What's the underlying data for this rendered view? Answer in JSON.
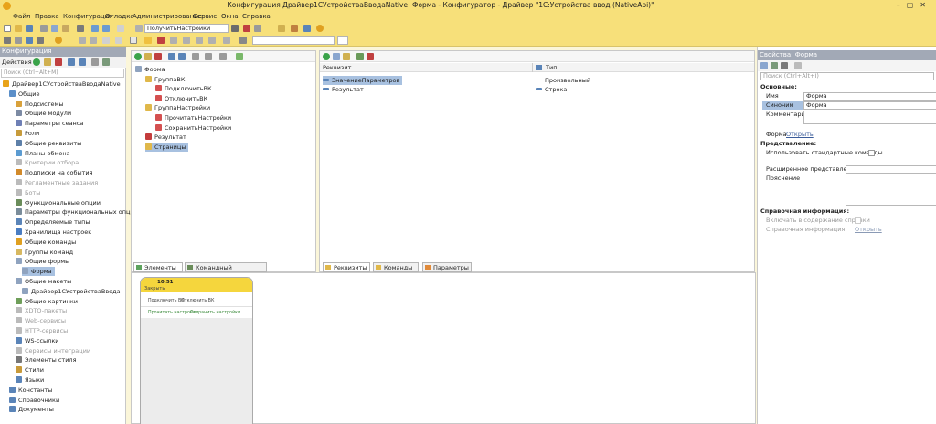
{
  "window": {
    "title": "Конфигурация Драйвер1СУстройстваВводаNative: Форма - Конфигуратор - Драйвер \"1С:Устройства ввод (NativeApi)\""
  },
  "menu": [
    "Файл",
    "Правка",
    "Конфигурация",
    "Отладка",
    "Администрирование",
    "Сервис",
    "Окна",
    "Справка"
  ],
  "toolbar": {
    "method_select": "ПолучитьНастройки"
  },
  "config_panel": {
    "title": "Конфигурация",
    "actions_label": "Действия ▾",
    "search_placeholder": "Поиск (Ctrl+Alt+M)",
    "tree": [
      {
        "label": "Драйвер1СУстройстваВводаNative",
        "level": 0,
        "muted": false,
        "selected": false,
        "color": "#e8a31a"
      },
      {
        "label": "Общие",
        "level": 1,
        "muted": false,
        "selected": false,
        "color": "#5b8fc9"
      },
      {
        "label": "Подсистемы",
        "level": 2,
        "muted": false,
        "selected": false,
        "color": "#d9a13b"
      },
      {
        "label": "Общие модули",
        "level": 2,
        "muted": false,
        "selected": false,
        "color": "#7c8aa3"
      },
      {
        "label": "Параметры сеанса",
        "level": 2,
        "muted": false,
        "selected": false,
        "color": "#6e7fb5"
      },
      {
        "label": "Роли",
        "level": 2,
        "muted": false,
        "selected": false,
        "color": "#c79b3b"
      },
      {
        "label": "Общие реквизиты",
        "level": 2,
        "muted": false,
        "selected": false,
        "color": "#5d7fa8"
      },
      {
        "label": "Планы обмена",
        "level": 2,
        "muted": false,
        "selected": false,
        "color": "#5b9bd1"
      },
      {
        "label": "Критерии отбора",
        "level": 2,
        "muted": true,
        "selected": false,
        "color": "#bbbbbb"
      },
      {
        "label": "Подписки на события",
        "level": 2,
        "muted": false,
        "selected": false,
        "color": "#d28a2a"
      },
      {
        "label": "Регламентные задания",
        "level": 2,
        "muted": true,
        "selected": false,
        "color": "#bbbbbb"
      },
      {
        "label": "Боты",
        "level": 2,
        "muted": true,
        "selected": false,
        "color": "#bbbbbb"
      },
      {
        "label": "Функциональные опции",
        "level": 2,
        "muted": false,
        "selected": false,
        "color": "#6a8c5a"
      },
      {
        "label": "Параметры функциональных опций",
        "level": 2,
        "muted": false,
        "selected": false,
        "color": "#7a8c9a"
      },
      {
        "label": "Определяемые типы",
        "level": 2,
        "muted": false,
        "selected": false,
        "color": "#5a84b8"
      },
      {
        "label": "Хранилища настроек",
        "level": 2,
        "muted": false,
        "selected": false,
        "color": "#4a7dc2"
      },
      {
        "label": "Общие команды",
        "level": 2,
        "muted": false,
        "selected": false,
        "color": "#e0a020"
      },
      {
        "label": "Группы команд",
        "level": 2,
        "muted": false,
        "selected": false,
        "color": "#d7b860"
      },
      {
        "label": "Общие формы",
        "level": 2,
        "muted": false,
        "selected": false,
        "color": "#8fa3bf"
      },
      {
        "label": "Форма",
        "level": 3,
        "muted": false,
        "selected": true,
        "color": "#8fa3bf"
      },
      {
        "label": "Общие макеты",
        "level": 2,
        "muted": false,
        "selected": false,
        "color": "#8fa3bf"
      },
      {
        "label": "Драйвер1СУстройстваВвода",
        "level": 3,
        "muted": false,
        "selected": false,
        "color": "#8fa3bf"
      },
      {
        "label": "Общие картинки",
        "level": 2,
        "muted": false,
        "selected": false,
        "color": "#6f9f5a"
      },
      {
        "label": "XDTO-пакеты",
        "level": 2,
        "muted": true,
        "selected": false,
        "color": "#bbbbbb"
      },
      {
        "label": "Web-сервисы",
        "level": 2,
        "muted": true,
        "selected": false,
        "color": "#bbbbbb"
      },
      {
        "label": "HTTP-сервисы",
        "level": 2,
        "muted": true,
        "selected": false,
        "color": "#bbbbbb"
      },
      {
        "label": "WS-ссылки",
        "level": 2,
        "muted": false,
        "selected": false,
        "color": "#5a84b8"
      },
      {
        "label": "Сервисы интеграции",
        "level": 2,
        "muted": true,
        "selected": false,
        "color": "#bbbbbb"
      },
      {
        "label": "Элементы стиля",
        "level": 2,
        "muted": false,
        "selected": false,
        "color": "#777777"
      },
      {
        "label": "Стили",
        "level": 2,
        "muted": false,
        "selected": false,
        "color": "#c89a3a"
      },
      {
        "label": "Языки",
        "level": 2,
        "muted": false,
        "selected": false,
        "color": "#5a84b8"
      },
      {
        "label": "Константы",
        "level": 1,
        "muted": false,
        "selected": false,
        "color": "#5a84b8"
      },
      {
        "label": "Справочники",
        "level": 1,
        "muted": false,
        "selected": false,
        "color": "#5a84b8"
      },
      {
        "label": "Документы",
        "level": 1,
        "muted": false,
        "selected": false,
        "color": "#5a84b8"
      }
    ]
  },
  "elements_panel": {
    "tree": [
      {
        "label": "Форма",
        "level": 0,
        "selected": false,
        "color": "#8fa3bf"
      },
      {
        "label": "ГруппаВК",
        "level": 1,
        "selected": false,
        "color": "#e0b84a"
      },
      {
        "label": "ПодключитьВК",
        "level": 2,
        "selected": false,
        "color": "#d45050"
      },
      {
        "label": "ОтключитьВК",
        "level": 2,
        "selected": false,
        "color": "#d45050"
      },
      {
        "label": "ГруппаНастройки",
        "level": 1,
        "selected": false,
        "color": "#e0b84a"
      },
      {
        "label": "ПрочитатьНастройки",
        "level": 2,
        "selected": false,
        "color": "#d45050"
      },
      {
        "label": "СохранитьНастройки",
        "level": 2,
        "selected": false,
        "color": "#d45050"
      },
      {
        "label": "Результат",
        "level": 1,
        "selected": false,
        "color": "#c43c3c"
      },
      {
        "label": "Страницы",
        "level": 1,
        "selected": true,
        "color": "#e0b84a"
      }
    ],
    "tabs": [
      "Элементы",
      "Командный интерфейс"
    ]
  },
  "requisites_panel": {
    "col_requisite": "Реквизит",
    "col_type": "Тип",
    "rows": [
      {
        "name": "ЗначениеПараметров",
        "type": "Произвольный",
        "selected": true
      },
      {
        "name": "Результат",
        "type": "Строка",
        "selected": false
      }
    ],
    "tabs": [
      "Реквизиты",
      "Команды",
      "Параметры"
    ]
  },
  "preview": {
    "time": "10:51",
    "close_label": "Закрыть",
    "row1": [
      "Подключить ВК",
      "Отключить ВК"
    ],
    "row2": [
      "Прочитать настройки",
      "Сохранить настройки"
    ]
  },
  "properties": {
    "title": "Свойства: Форма",
    "search_placeholder": "Поиск (Ctrl+Alt+I)",
    "section_basic": "Основные:",
    "name_label": "Имя",
    "name_value": "Форма",
    "synonym_label": "Синоним",
    "synonym_value": "Форма",
    "comment_label": "Комментарий",
    "form_label": "Форма",
    "open_link": "Открыть",
    "section_view": "Представление:",
    "use_std_commands": "Использовать стандартные команды",
    "extended_view": "Расширенное представление",
    "explanation": "Пояснение",
    "section_help": "Справочная информация:",
    "include_in_help": "Включать в содержание справки",
    "help_info": "Справочная информация",
    "help_open": "Открыть"
  }
}
